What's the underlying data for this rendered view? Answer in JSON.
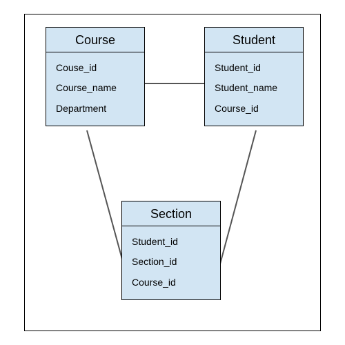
{
  "entities": {
    "course": {
      "title": "Course",
      "attrs": [
        "Couse_id",
        "Course_name",
        "Department"
      ]
    },
    "student": {
      "title": "Student",
      "attrs": [
        "Student_id",
        "Student_name",
        "Course_id"
      ]
    },
    "section": {
      "title": "Section",
      "attrs": [
        "Student_id",
        "Section_id",
        "Course_id"
      ]
    }
  }
}
